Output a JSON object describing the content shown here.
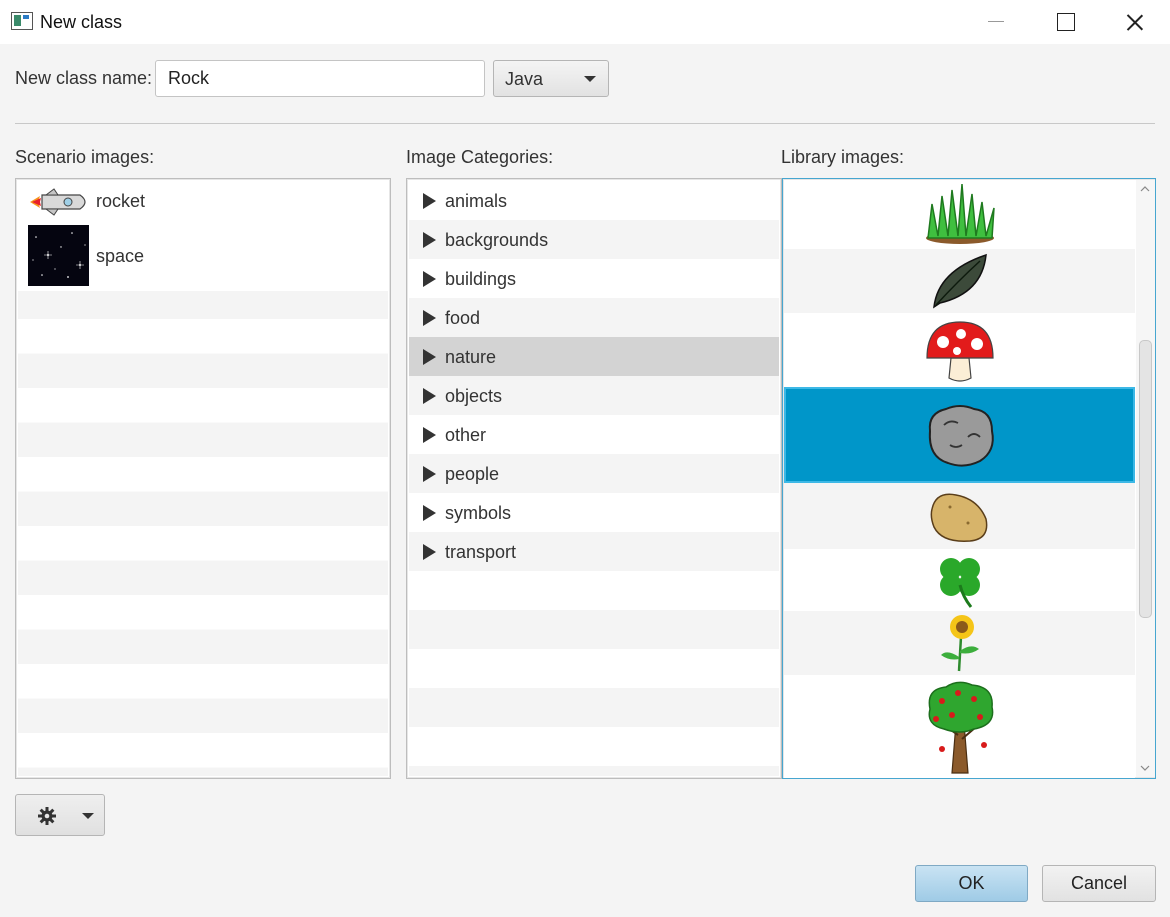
{
  "window": {
    "title": "New class"
  },
  "name_row": {
    "label": "New class name:",
    "value": "Rock",
    "language": "Java"
  },
  "labels": {
    "scenario": "Scenario images:",
    "categories": "Image Categories:",
    "library": "Library images:"
  },
  "scenario_images": [
    {
      "name": "rocket",
      "icon": "rocket-icon"
    },
    {
      "name": "space",
      "icon": "space-thumbnail"
    }
  ],
  "categories": [
    "animals",
    "backgrounds",
    "buildings",
    "food",
    "nature",
    "objects",
    "other",
    "people",
    "symbols",
    "transport"
  ],
  "selected_category": "nature",
  "library_images": [
    {
      "icon": "grass-icon"
    },
    {
      "icon": "leaf-icon"
    },
    {
      "icon": "mushroom-icon"
    },
    {
      "icon": "rock-icon",
      "selected": true
    },
    {
      "icon": "potato-icon"
    },
    {
      "icon": "clover-icon"
    },
    {
      "icon": "sunflower-icon"
    },
    {
      "icon": "apple-tree-icon"
    }
  ],
  "buttons": {
    "ok": "OK",
    "cancel": "Cancel",
    "options": "gear-icon"
  },
  "colors": {
    "selection": "#0096c9",
    "category_selection": "#d3d3d3",
    "ok_button": "#b4d6ec"
  }
}
